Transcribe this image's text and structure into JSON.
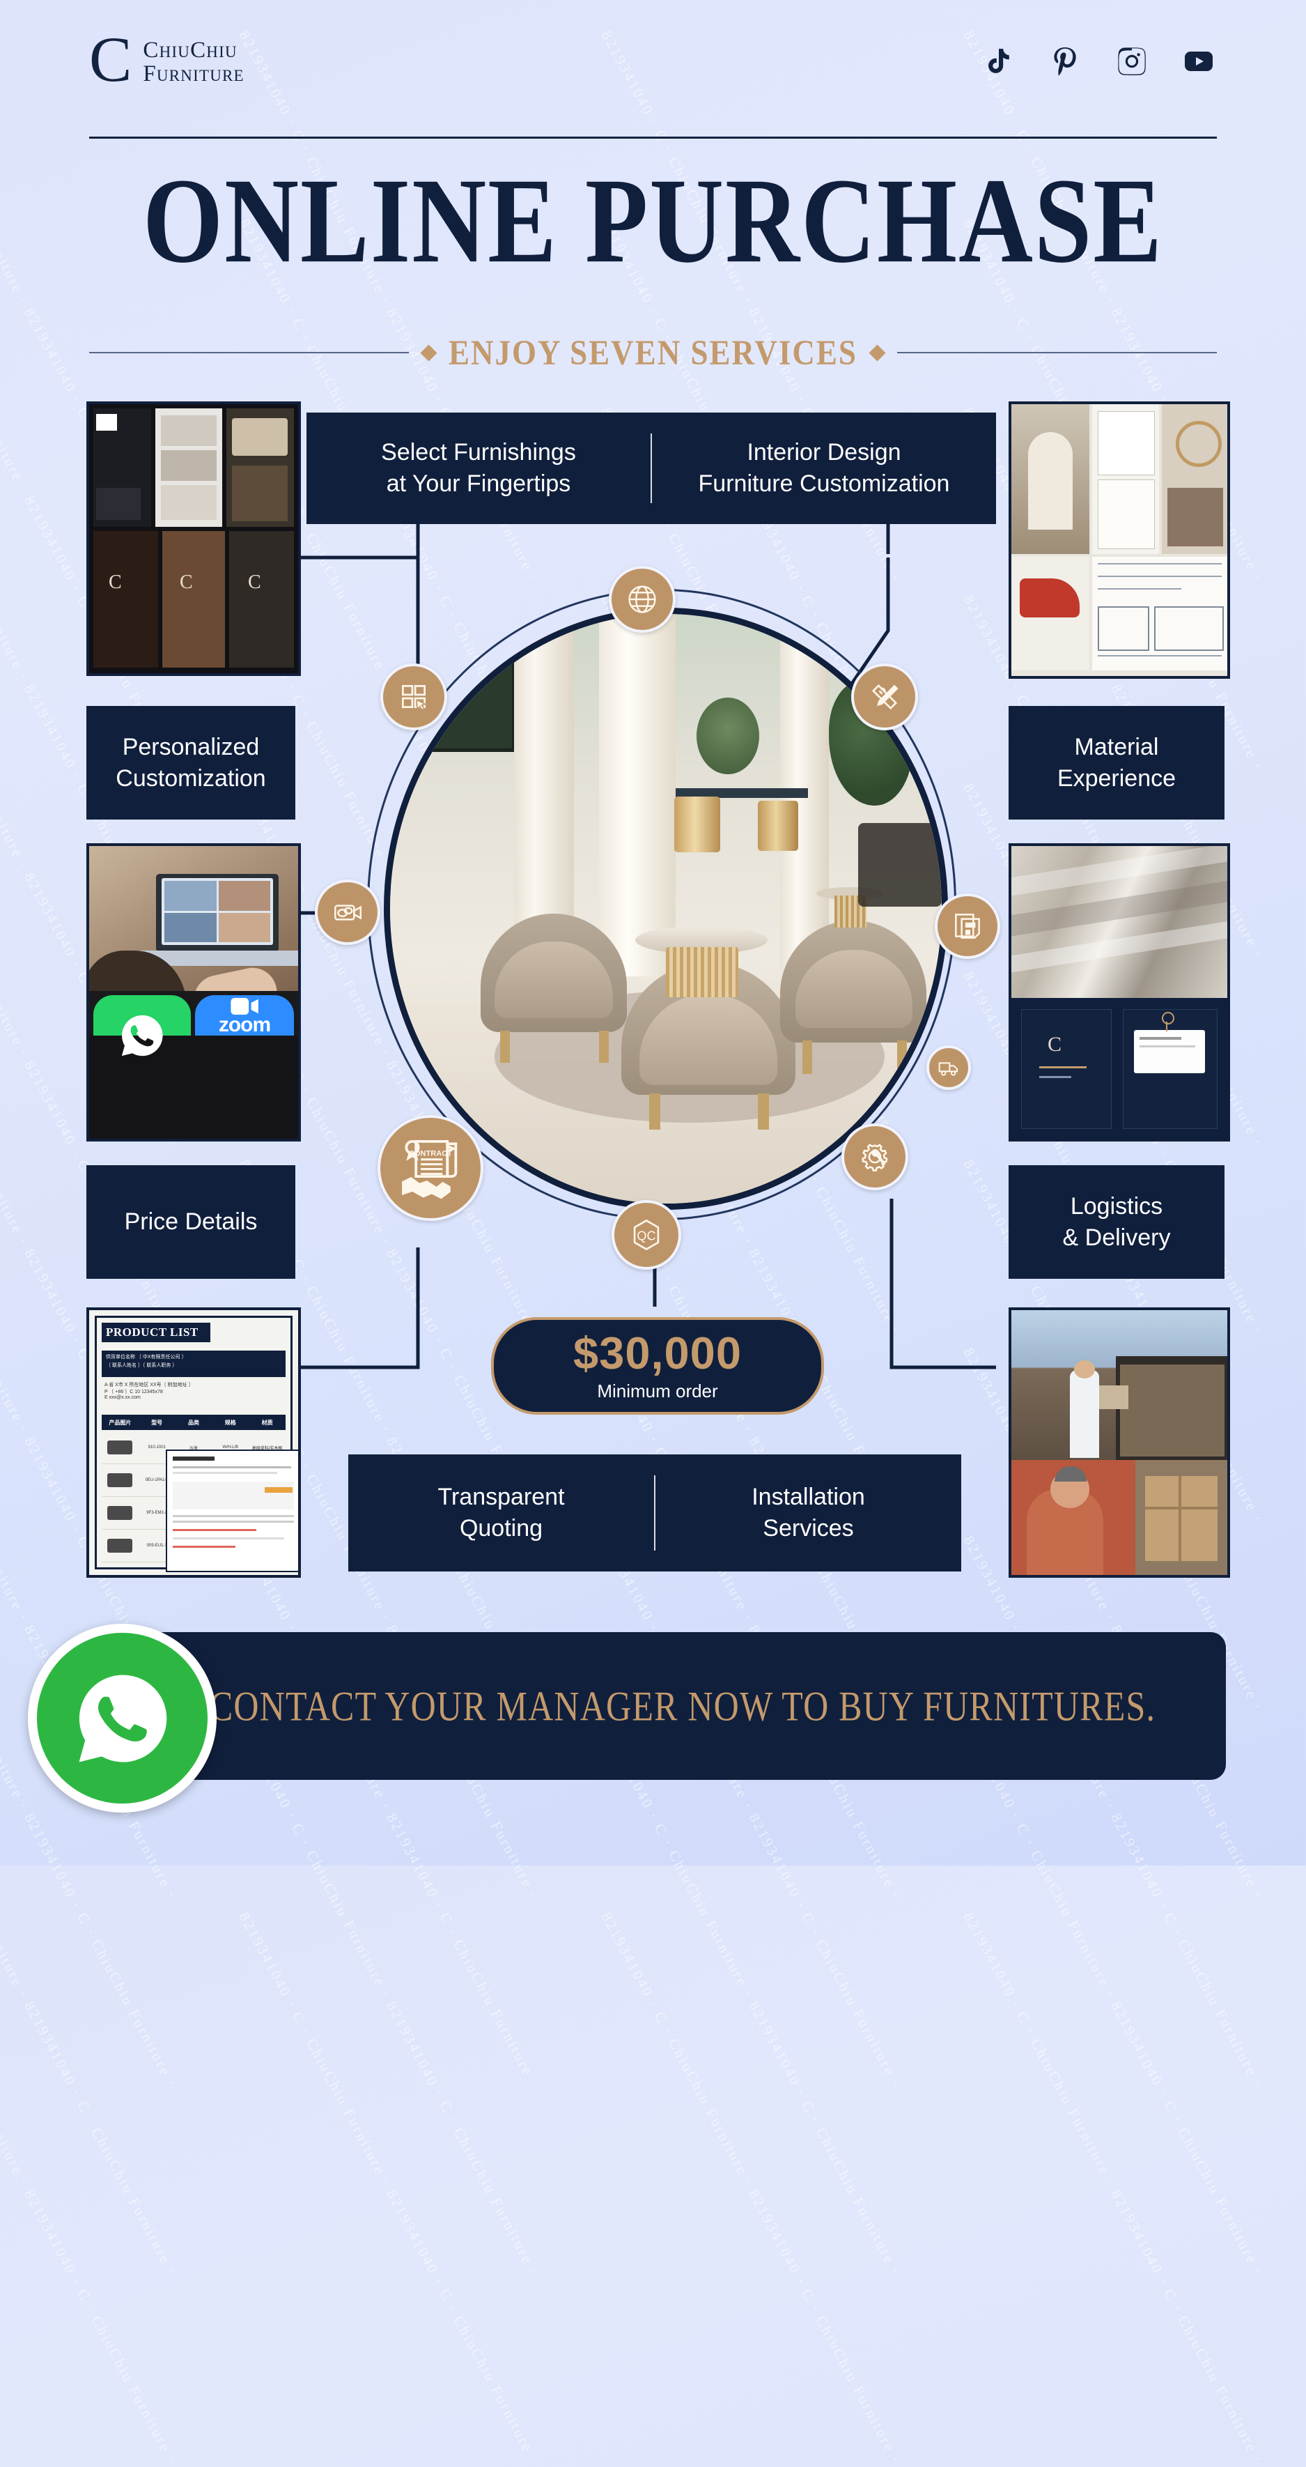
{
  "brand": {
    "mark": "C",
    "line1": "ChiuChiu",
    "line2": "Furniture",
    "watermark": "8219341040  ·  C  ·  ChiuChiu Furniture  ·"
  },
  "socials": [
    {
      "name": "tiktok-icon",
      "label": "TikTok"
    },
    {
      "name": "pinterest-icon",
      "label": "Pinterest"
    },
    {
      "name": "instagram-icon",
      "label": "Instagram"
    },
    {
      "name": "youtube-icon",
      "label": "YouTube"
    }
  ],
  "hero": {
    "title": "ONLINE PURCHASE",
    "subtitle": "ENJOY SEVEN SERVICES"
  },
  "top_banner": {
    "left": "Select Furnishings\nat Your Fingertips",
    "left_l1": "Select Furnishings",
    "left_l2": "at Your Fingertips",
    "right_l1": "Interior Design",
    "right_l2": "Furniture Customization"
  },
  "bottom_banner": {
    "left_l1": "Transparent",
    "left_l2": "Quoting",
    "right_l1": "Installation",
    "right_l2": "Services"
  },
  "side_labels": {
    "personalized_l1": "Personalized",
    "personalized_l2": "Customization",
    "material_l1": "Material",
    "material_l2": "Experience",
    "price_details": "Price Details",
    "logistics_l1": "Logistics",
    "logistics_l2": "& Delivery"
  },
  "badges": [
    {
      "icon": "globe-icon",
      "label": "Global online catalog"
    },
    {
      "icon": "grid-cursor-icon",
      "label": "Select furnishings"
    },
    {
      "icon": "ruler-pencil-icon",
      "label": "Interior design"
    },
    {
      "icon": "video-chat-icon",
      "label": "Video consultation"
    },
    {
      "icon": "material-swatch-icon",
      "label": "Material experience"
    },
    {
      "icon": "contract-handshake-icon",
      "label": "Contract"
    },
    {
      "icon": "qc-shield-icon",
      "label": "Quality control"
    },
    {
      "icon": "gear-wrench-icon",
      "label": "Installation"
    },
    {
      "icon": "delivery-truck-icon",
      "label": "Logistics"
    }
  ],
  "badge_text": {
    "contract": "CONTRACT",
    "qc": "QC"
  },
  "price": {
    "amount": "$30,000",
    "caption": "Minimum order"
  },
  "cta": {
    "text": "CONTACT YOUR MANAGER NOW TO BUY FURNITURES.",
    "icon": "whatsapp-icon"
  },
  "thumbnails": {
    "product_list_title": "PRODUCT LIST",
    "product_list_company": "供货单位名称 〔 中X有限责任公司 〕",
    "product_list_contact": "〔 联系人姓名 〕〔 联系人职务 〕",
    "product_list_addr": "A  省 X市 X 所在地区 XX号〔 附加地址 〕",
    "product_list_phone": "P  〔 +86 〕C 10 12345x78",
    "product_list_mail": "E  xxx@x.xx.com",
    "product_list_cols": [
      "产品图片",
      "型号",
      "品类",
      "规格",
      "材质"
    ],
    "product_rows": [
      {
        "model": "910-1001",
        "cat": "沙发",
        "spec": "W/H-L/B",
        "mat": "高级皮料/实木框"
      },
      {
        "model": "0EU-1PA1-2",
        "cat": "",
        "spec": "",
        "mat": ""
      },
      {
        "model": "9F3-EM2-2",
        "cat": "",
        "spec": "",
        "mat": ""
      },
      {
        "model": "009-EU1-1",
        "cat": "",
        "spec": "",
        "mat": ""
      }
    ],
    "apps": [
      {
        "name": "whatsapp-tile",
        "label": "WhatsApp",
        "color": "#25d366"
      },
      {
        "name": "zoom-tile",
        "label": "zoom",
        "color": "#2d8cff"
      }
    ]
  },
  "colors": {
    "navy": "#101f3c",
    "gold": "#c49a6c",
    "badge": "#bd9468",
    "bg_top": "#dde4fb",
    "bg_bottom": "#cfd9fa",
    "whatsapp_green": "#2db742"
  }
}
